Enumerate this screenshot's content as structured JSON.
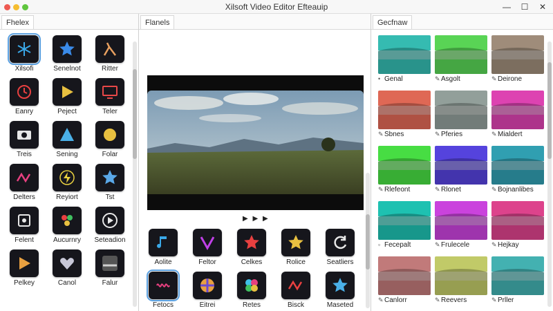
{
  "window": {
    "title": "Xilsoft Video Editor Efteauip",
    "controls": {
      "minimize": "—",
      "maximize": "☐",
      "close": "✕"
    }
  },
  "left_panel": {
    "tab": "Fhelex",
    "items": [
      {
        "label": "Xilsofi",
        "icon": "snowflake-icon",
        "color": "#3aa8e8",
        "selected": true
      },
      {
        "label": "Senelnot",
        "icon": "star-icon",
        "color": "#3a8ae8",
        "selected": false
      },
      {
        "label": "Ritter",
        "icon": "lambda-icon",
        "color": "#e8a060",
        "selected": false
      },
      {
        "label": "Eanry",
        "icon": "clock-icon",
        "color": "#e84040",
        "selected": false
      },
      {
        "label": "Peject",
        "icon": "play-triangle-icon",
        "color": "#e8c040",
        "selected": false
      },
      {
        "label": "Teler",
        "icon": "monitor-icon",
        "color": "#e84848",
        "selected": false
      },
      {
        "label": "Treis",
        "icon": "camera-icon",
        "color": "#e8e8e8",
        "selected": false
      },
      {
        "label": "Sening",
        "icon": "triangle-icon",
        "color": "#4ab0e8",
        "selected": false
      },
      {
        "label": "Folar",
        "icon": "circle-icon",
        "color": "#e8c040",
        "selected": false
      },
      {
        "label": "Delters",
        "icon": "zigzag-icon",
        "color": "#e84080",
        "selected": false
      },
      {
        "label": "Reyiort",
        "icon": "bolt-icon",
        "color": "#e8d040",
        "selected": false
      },
      {
        "label": "Tst",
        "icon": "star-icon",
        "color": "#5aa8e8",
        "selected": false
      },
      {
        "label": "Felent",
        "icon": "puzzle-icon",
        "color": "#e8e8e8",
        "selected": false
      },
      {
        "label": "Aucurnry",
        "icon": "dots-icon",
        "color": "#e84040",
        "selected": false
      },
      {
        "label": "Seteadion",
        "icon": "play-circle-icon",
        "color": "#e8e8e8",
        "selected": false
      },
      {
        "label": "Pelkey",
        "icon": "play-triangle-icon",
        "color": "#e8a040",
        "selected": false
      },
      {
        "label": "Canol",
        "icon": "heart-icon",
        "color": "#c8c8d8",
        "selected": false
      },
      {
        "label": "Falur",
        "icon": "fog-icon",
        "color": "#d0d0d0",
        "selected": false
      }
    ]
  },
  "center_panel": {
    "tab": "Flanels",
    "playback": "▶ ▶ ▶",
    "items": [
      {
        "label": "Aolite",
        "icon": "note-icon",
        "color": "#3aa8e8",
        "selected": false
      },
      {
        "label": "Feltor",
        "icon": "v-icon",
        "color": "#c040e8",
        "selected": false
      },
      {
        "label": "Celkes",
        "icon": "star-icon",
        "color": "#e84040",
        "selected": false
      },
      {
        "label": "Rolice",
        "icon": "star-icon",
        "color": "#e8c040",
        "selected": false
      },
      {
        "label": "Seatliers",
        "icon": "refresh-icon",
        "color": "#e8e8e8",
        "selected": false
      },
      {
        "label": "Fetocs",
        "icon": "waves-icon",
        "color": "#e84080",
        "selected": true
      },
      {
        "label": "Eitrei",
        "icon": "wheel-icon",
        "color": "#e8a040",
        "selected": false
      },
      {
        "label": "Retes",
        "icon": "flower-icon",
        "color": "#40c0e8",
        "selected": false
      },
      {
        "label": "Bisck",
        "icon": "zigzag-icon",
        "color": "#e84040",
        "selected": false
      },
      {
        "label": "Maseted",
        "icon": "star-icon",
        "color": "#4ab0e8",
        "selected": false
      }
    ]
  },
  "right_panel": {
    "tab": "Gecfnaw",
    "items": [
      {
        "label": "Genal",
        "icon": "dot-icon",
        "tint": "#2ea39a"
      },
      {
        "label": "Asgolt",
        "icon": "edit-icon",
        "tint": "#4db84a"
      },
      {
        "label": "Deirone",
        "icon": "edit-icon",
        "tint": "#8a7a6a"
      },
      {
        "label": "Sbnes",
        "icon": "edit-icon",
        "tint": "#c25a4a"
      },
      {
        "label": "Pferies",
        "icon": "edit-icon",
        "tint": "#7f8a86"
      },
      {
        "label": "Mialdert",
        "icon": "edit-icon",
        "tint": "#c03a9a"
      },
      {
        "label": "Rlefeont",
        "icon": "edit-icon",
        "tint": "#3ec03a"
      },
      {
        "label": "Rlonet",
        "icon": "edit-icon",
        "tint": "#4a3ac0"
      },
      {
        "label": "Bojnanlibes",
        "icon": "edit-icon",
        "tint": "#2a8a9a"
      },
      {
        "label": "Fecepalt",
        "icon": "box-icon",
        "tint": "#1aa89a"
      },
      {
        "label": "Frulecele",
        "icon": "edit-icon",
        "tint": "#b03ac0"
      },
      {
        "label": "Hejkay",
        "icon": "edit-icon",
        "tint": "#c03a7a"
      },
      {
        "label": "Canlorr",
        "icon": "edit-icon",
        "tint": "#a86a6a"
      },
      {
        "label": "Reevers",
        "icon": "edit-icon",
        "tint": "#a8b05a"
      },
      {
        "label": "Prller",
        "icon": "edit-icon",
        "tint": "#3a9a9a"
      }
    ]
  }
}
